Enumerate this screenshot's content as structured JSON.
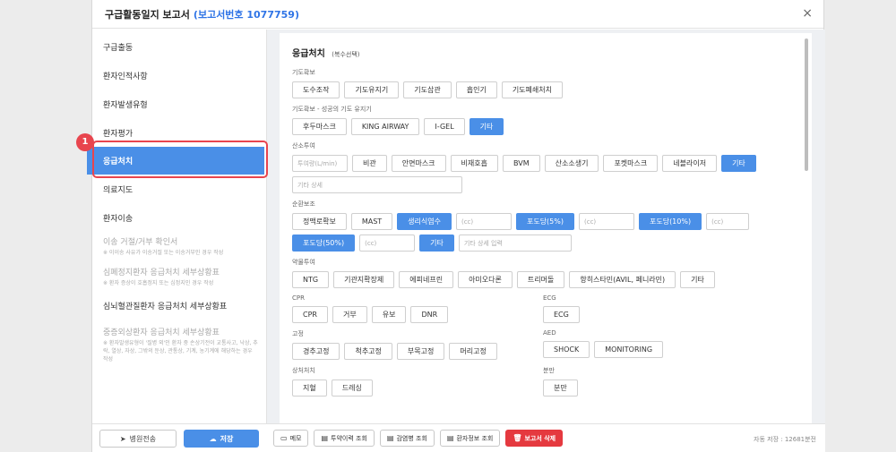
{
  "window": {
    "title": "구급활동일지 보고서",
    "report_no": "(보고서번호 1077759)",
    "close_icon": "×"
  },
  "sidebar": {
    "items": [
      {
        "label": "구급출동"
      },
      {
        "label": "환자인적사항"
      },
      {
        "label": "환자발생유형"
      },
      {
        "label": "환자평가"
      },
      {
        "label": "응급처치"
      },
      {
        "label": "의료지도"
      },
      {
        "label": "환자이송"
      }
    ],
    "blocks": [
      {
        "title": "이송 거절/거부 확인서",
        "sub": "※ 이이송 사유가 이송거절 또는 이송거부인 경우 작성"
      },
      {
        "title": "심폐정지환자 응급처치 세부상황표",
        "sub": "※ 환자 증상이 호흡정지 또는 심정지인 경우 작성"
      },
      {
        "title": "심뇌혈관질환자 응급처치 세부상황표",
        "sub": ""
      },
      {
        "title": "중증외상환자 응급처치 세부상황표",
        "sub": "※ 환자발생유형이 '질병 외'인 환자 중 손상기전이 교통사고, 낙상, 추락, 열상, 자상, 그밖의 둔상, 관통상, 기계, 농기계에 해당하는 경우 작성"
      }
    ],
    "callout_number": "1",
    "bottom": {
      "transfer": "병원전송",
      "save": "저장"
    }
  },
  "panel": {
    "title": "응급처치",
    "title_note": "(복수선택)",
    "airway": {
      "label": "기도확보",
      "options": [
        "도수조작",
        "기도유지기",
        "기도삽관",
        "흡인기",
        "기도폐쇄처치"
      ]
    },
    "adv_airway": {
      "label": "기도확보 - 성공의 기도 유지기",
      "options": [
        "후두마스크",
        "KING AIRWAY",
        "I-GEL",
        "기타"
      ]
    },
    "oxygen": {
      "label": "산소투여",
      "flow_placeholder": "투여량(L/min)",
      "options": [
        "비관",
        "안면마스크",
        "비재호흡",
        "BVM",
        "산소소생기",
        "포켓마스크",
        "네블라이저",
        "기타"
      ],
      "detail_placeholder": "기타 상세"
    },
    "circulation": {
      "label": "순환보조",
      "options": [
        "정맥로확보",
        "MAST",
        "생리식염수",
        "포도당(5%)",
        "포도당(10%)",
        "포도당(50%)",
        "기타"
      ],
      "cc_placeholder": "(cc)",
      "detail_placeholder": "기타 상세 입력"
    },
    "drugs": {
      "label": "약물투여",
      "options": [
        "NTG",
        "기관지확장제",
        "에피네프린",
        "아미오다론",
        "트리머돌",
        "항히스타민(AVIL, 페니라민)",
        "기타"
      ]
    },
    "cpr": {
      "label": "CPR",
      "options": [
        "CPR",
        "거부",
        "유보",
        "DNR"
      ]
    },
    "ecg": {
      "label": "ECG",
      "options": [
        "ECG"
      ]
    },
    "fixation": {
      "label": "고정",
      "options": [
        "경추고정",
        "척추고정",
        "부목고정",
        "머리고정"
      ]
    },
    "aed": {
      "label": "AED",
      "options": [
        "SHOCK",
        "MONITORING"
      ]
    },
    "wound": {
      "label": "상처처치",
      "options": [
        "지혈",
        "드레싱"
      ]
    },
    "delivery": {
      "label": "분만",
      "options": [
        "분만"
      ]
    }
  },
  "bottombar": {
    "memo": "메모",
    "drug_history": "투약이력 조회",
    "infection": "감염병 조회",
    "patient_info": "환자정보 조회",
    "delete": "보고서 삭제",
    "autosave": "자동 저장 : 12681분전"
  },
  "colors": {
    "accent": "#4a8fe7",
    "danger": "#e5393f",
    "title_accent": "#2f74e6"
  }
}
